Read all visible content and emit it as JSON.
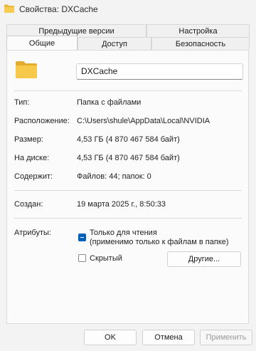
{
  "window": {
    "title": "Свойства: DXCache",
    "icon": "folder-icon"
  },
  "tabs": {
    "back_row": [
      "Предыдущие версии",
      "Настройка"
    ],
    "front_row": [
      "Общие",
      "Доступ",
      "Безопасность"
    ],
    "active": "Общие"
  },
  "general": {
    "name": "DXCache",
    "rows": [
      {
        "label": "Тип:",
        "value": "Папка с файлами"
      },
      {
        "label": "Расположение:",
        "value": "C:\\Users\\shule\\AppData\\Local\\NVIDIA"
      },
      {
        "label": "Размер:",
        "value": "4,53 ГБ (4 870 467 584 байт)"
      },
      {
        "label": "На диске:",
        "value": "4,53 ГБ (4 870 467 584 байт)"
      },
      {
        "label": "Содержит:",
        "value": "Файлов: 44; папок: 0"
      },
      {
        "label": "Создан:",
        "value": "19 марта 2025 г., 8:50:33"
      }
    ],
    "attributes_label": "Атрибуты:",
    "readonly_label": "Только для чтения",
    "readonly_note": "(применимо только к файлам в папке)",
    "readonly_state": "indeterminate",
    "hidden_label": "Скрытый",
    "hidden_state": "unchecked",
    "other_button": "Другие..."
  },
  "footer": {
    "ok": "OK",
    "cancel": "Отмена",
    "apply": "Применить"
  },
  "colors": {
    "accent": "#005fb8",
    "folder_yellow": "#f4c542",
    "disabled_text": "#9a9a9a"
  }
}
